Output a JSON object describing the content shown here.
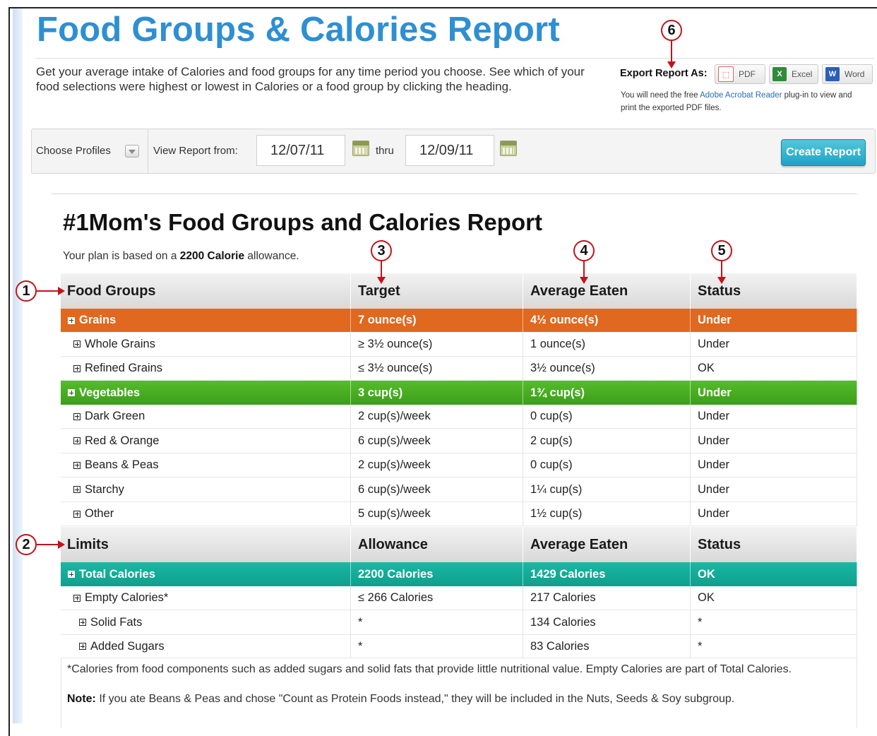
{
  "page": {
    "title": "Food Groups & Calories Report",
    "intro": "Get your average intake of Calories and food groups for any time period you choose. See which of your food selections were highest or lowest in Calories or a food group by clicking the heading."
  },
  "export": {
    "label": "Export Report As:",
    "pdf": "PDF",
    "excel": "Excel",
    "word": "Word",
    "note_pre": "You will need the free ",
    "note_link": "Adobe Acrobat Reader",
    "note_post": " plug-in to view and print the exported PDF files."
  },
  "filters": {
    "choose_profiles": "Choose Profiles",
    "view_report_from": "View Report from:",
    "from_date": "12/07/11",
    "thru": "thru",
    "to_date": "12/09/11",
    "create_button": "Create Report"
  },
  "report": {
    "title": "#1Mom's Food Groups and Calories Report",
    "plan_pre": "Your plan is based on a ",
    "plan_bold": "2200 Calorie",
    "plan_post": " allowance."
  },
  "food_table": {
    "headers": [
      "Food Groups",
      "Target",
      "Average Eaten",
      "Status"
    ],
    "rows": [
      {
        "name": "Grains",
        "target": "7 ounce(s)",
        "eaten": "4½ ounce(s)",
        "status": "Under"
      },
      {
        "name": "Whole Grains",
        "target": "≥ 3½ ounce(s)",
        "eaten": "1 ounce(s)",
        "status": "Under"
      },
      {
        "name": "Refined Grains",
        "target": "≤ 3½ ounce(s)",
        "eaten": "3½ ounce(s)",
        "status": "OK"
      },
      {
        "name": "Vegetables",
        "target": "3 cup(s)",
        "eaten": "1¾ cup(s)",
        "status": "Under"
      },
      {
        "name": "Dark Green",
        "target": "2 cup(s)/week",
        "eaten": "0 cup(s)",
        "status": "Under"
      },
      {
        "name": "Red & Orange",
        "target": "6 cup(s)/week",
        "eaten": "2 cup(s)",
        "status": "Under"
      },
      {
        "name": "Beans & Peas",
        "target": "2 cup(s)/week",
        "eaten": "0 cup(s)",
        "status": "Under"
      },
      {
        "name": "Starchy",
        "target": "6 cup(s)/week",
        "eaten": "1¼ cup(s)",
        "status": "Under"
      },
      {
        "name": "Other",
        "target": "5 cup(s)/week",
        "eaten": "1½ cup(s)",
        "status": "Under"
      }
    ]
  },
  "limits_table": {
    "headers": [
      "Limits",
      "Allowance",
      "Average Eaten",
      "Status"
    ],
    "rows": [
      {
        "name": "Total Calories",
        "target": "2200 Calories",
        "eaten": "1429 Calories",
        "status": "OK"
      },
      {
        "name": "Empty Calories*",
        "target": "≤ 266 Calories",
        "eaten": "217 Calories",
        "status": "OK"
      },
      {
        "name": "Solid Fats",
        "target": "*",
        "eaten": "134 Calories",
        "status": "*"
      },
      {
        "name": "Added Sugars",
        "target": "*",
        "eaten": "83 Calories",
        "status": "*"
      }
    ]
  },
  "footnote": "*Calories from food components such as added sugars and solid fats that provide little nutritional value. Empty Calories are part of Total Calories.",
  "note": {
    "label": "Note:",
    "text": " If you ate Beans & Peas and chose \"Count as Protein Foods instead,\" they will be included in the Nuts, Seeds & Soy subgroup."
  },
  "callouts": [
    "1",
    "2",
    "3",
    "4",
    "5",
    "6"
  ],
  "colors": {
    "title": "#2e8fd2",
    "grains": "#e0681f",
    "vegetables": "#46ad22",
    "calories": "#14ac98",
    "callout": "#c0141b",
    "create_button": "#2ab0cc"
  },
  "icons": [
    "dropdown-arrow-icon",
    "calendar-icon",
    "pdf-icon",
    "excel-icon",
    "word-icon",
    "expand-plus-icon"
  ]
}
